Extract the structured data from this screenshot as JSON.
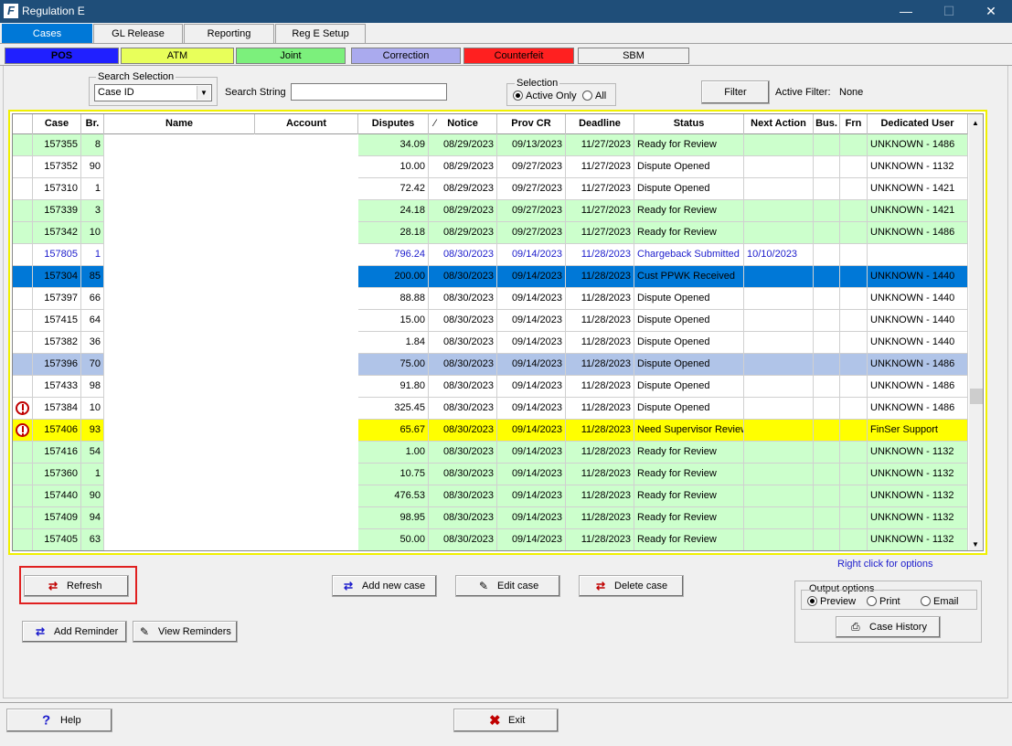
{
  "window": {
    "title": "Regulation E",
    "app_icon": "F",
    "minimize": "—",
    "maximize": "☐",
    "close": "✕"
  },
  "tabs": [
    {
      "label": "Cases",
      "active": true
    },
    {
      "label": "GL Release",
      "active": false
    },
    {
      "label": "Reporting",
      "active": false
    },
    {
      "label": "Reg E Setup",
      "active": false
    }
  ],
  "subtabs": [
    {
      "label": "POS",
      "bg": "#2020ff",
      "fg": "#000000",
      "active": true
    },
    {
      "label": "ATM",
      "bg": "#e8ff5a",
      "fg": "#000000"
    },
    {
      "label": "Joint",
      "bg": "#7cf07c",
      "fg": "#000000"
    },
    {
      "label": "Correction",
      "bg": "#aaaaee",
      "fg": "#000000"
    },
    {
      "label": "Counterfeit",
      "bg": "#ff2020",
      "fg": "#000000"
    },
    {
      "label": "SBM",
      "bg": "#f0f0f0",
      "fg": "#000000"
    }
  ],
  "search": {
    "group_label": "Search Selection",
    "field_value": "Case ID",
    "string_label": "Search String",
    "string_value": ""
  },
  "selection": {
    "group_label": "Selection",
    "active_only": "Active Only",
    "all": "All",
    "selected": "active_only"
  },
  "filter": {
    "button_label": "Filter",
    "active_filter_label": "Active Filter:",
    "active_filter_value": "None"
  },
  "grid": {
    "columns": [
      "",
      "Case",
      "Br.",
      "Name",
      "Account",
      "Disputes",
      "Notice",
      "Prov CR",
      "Deadline",
      "Status",
      "Next Action",
      "Bus.",
      "Frn",
      "Dedicated User"
    ],
    "sort_indicator": "⁄",
    "rows": [
      {
        "alert": false,
        "case": "157355",
        "br": "8",
        "disputes": "34.09",
        "notice": "08/29/2023",
        "prov_cr": "09/13/2023",
        "deadline": "11/27/2023",
        "status": "Ready for Review",
        "next_action": "",
        "bus": "",
        "frn": "",
        "user": "UNKNOWN - 1486",
        "style": "green"
      },
      {
        "alert": false,
        "case": "157352",
        "br": "90",
        "disputes": "10.00",
        "notice": "08/29/2023",
        "prov_cr": "09/27/2023",
        "deadline": "11/27/2023",
        "status": "Dispute Opened",
        "next_action": "",
        "bus": "",
        "frn": "",
        "user": "UNKNOWN - 1132",
        "style": "white"
      },
      {
        "alert": false,
        "case": "157310",
        "br": "1",
        "disputes": "72.42",
        "notice": "08/29/2023",
        "prov_cr": "09/27/2023",
        "deadline": "11/27/2023",
        "status": "Dispute Opened",
        "next_action": "",
        "bus": "",
        "frn": "",
        "user": "UNKNOWN - 1421",
        "style": "white"
      },
      {
        "alert": false,
        "case": "157339",
        "br": "3",
        "disputes": "24.18",
        "notice": "08/29/2023",
        "prov_cr": "09/27/2023",
        "deadline": "11/27/2023",
        "status": "Ready for Review",
        "next_action": "",
        "bus": "",
        "frn": "",
        "user": "UNKNOWN - 1421",
        "style": "green"
      },
      {
        "alert": false,
        "case": "157342",
        "br": "10",
        "disputes": "28.18",
        "notice": "08/29/2023",
        "prov_cr": "09/27/2023",
        "deadline": "11/27/2023",
        "status": "Ready for Review",
        "next_action": "",
        "bus": "",
        "frn": "",
        "user": "UNKNOWN - 1486",
        "style": "green"
      },
      {
        "alert": false,
        "case": "157805",
        "br": "1",
        "disputes": "796.24",
        "notice": "08/30/2023",
        "prov_cr": "09/14/2023",
        "deadline": "11/28/2023",
        "status": "Chargeback Submitted",
        "next_action": "10/10/2023",
        "bus": "",
        "frn": "",
        "user": "",
        "style": "blue-text"
      },
      {
        "alert": false,
        "case": "157304",
        "br": "85",
        "disputes": "200.00",
        "notice": "08/30/2023",
        "prov_cr": "09/14/2023",
        "deadline": "11/28/2023",
        "status": "Cust PPWK Received",
        "next_action": "",
        "bus": "",
        "frn": "",
        "user": "UNKNOWN - 1440",
        "style": "selected"
      },
      {
        "alert": false,
        "case": "157397",
        "br": "66",
        "disputes": "88.88",
        "notice": "08/30/2023",
        "prov_cr": "09/14/2023",
        "deadline": "11/28/2023",
        "status": "Dispute Opened",
        "next_action": "",
        "bus": "",
        "frn": "",
        "user": "UNKNOWN - 1440",
        "style": "white"
      },
      {
        "alert": false,
        "case": "157415",
        "br": "64",
        "disputes": "15.00",
        "notice": "08/30/2023",
        "prov_cr": "09/14/2023",
        "deadline": "11/28/2023",
        "status": "Dispute Opened",
        "next_action": "",
        "bus": "",
        "frn": "",
        "user": "UNKNOWN - 1440",
        "style": "white"
      },
      {
        "alert": false,
        "case": "157382",
        "br": "36",
        "disputes": "1.84",
        "notice": "08/30/2023",
        "prov_cr": "09/14/2023",
        "deadline": "11/28/2023",
        "status": "Dispute Opened",
        "next_action": "",
        "bus": "",
        "frn": "",
        "user": "UNKNOWN - 1440",
        "style": "white"
      },
      {
        "alert": false,
        "case": "157396",
        "br": "70",
        "disputes": "75.00",
        "notice": "08/30/2023",
        "prov_cr": "09/14/2023",
        "deadline": "11/28/2023",
        "status": "Dispute Opened",
        "next_action": "",
        "bus": "",
        "frn": "",
        "user": "UNKNOWN - 1486",
        "style": "lavender"
      },
      {
        "alert": false,
        "case": "157433",
        "br": "98",
        "disputes": "91.80",
        "notice": "08/30/2023",
        "prov_cr": "09/14/2023",
        "deadline": "11/28/2023",
        "status": "Dispute Opened",
        "next_action": "",
        "bus": "",
        "frn": "",
        "user": "UNKNOWN - 1486",
        "style": "white"
      },
      {
        "alert": true,
        "case": "157384",
        "br": "10",
        "disputes": "325.45",
        "notice": "08/30/2023",
        "prov_cr": "09/14/2023",
        "deadline": "11/28/2023",
        "status": "Dispute Opened",
        "next_action": "",
        "bus": "",
        "frn": "",
        "user": "UNKNOWN - 1486",
        "style": "white"
      },
      {
        "alert": true,
        "case": "157406",
        "br": "93",
        "disputes": "65.67",
        "notice": "08/30/2023",
        "prov_cr": "09/14/2023",
        "deadline": "11/28/2023",
        "status": "Need Supervisor Review",
        "next_action": "",
        "bus": "",
        "frn": "",
        "user": "FinSer Support",
        "style": "yellow"
      },
      {
        "alert": false,
        "case": "157416",
        "br": "54",
        "disputes": "1.00",
        "notice": "08/30/2023",
        "prov_cr": "09/14/2023",
        "deadline": "11/28/2023",
        "status": "Ready for Review",
        "next_action": "",
        "bus": "",
        "frn": "",
        "user": "UNKNOWN - 1132",
        "style": "green"
      },
      {
        "alert": false,
        "case": "157360",
        "br": "1",
        "disputes": "10.75",
        "notice": "08/30/2023",
        "prov_cr": "09/14/2023",
        "deadline": "11/28/2023",
        "status": "Ready for Review",
        "next_action": "",
        "bus": "",
        "frn": "",
        "user": "UNKNOWN - 1132",
        "style": "green"
      },
      {
        "alert": false,
        "case": "157440",
        "br": "90",
        "disputes": "476.53",
        "notice": "08/30/2023",
        "prov_cr": "09/14/2023",
        "deadline": "11/28/2023",
        "status": "Ready for Review",
        "next_action": "",
        "bus": "",
        "frn": "",
        "user": "UNKNOWN - 1132",
        "style": "green"
      },
      {
        "alert": false,
        "case": "157409",
        "br": "94",
        "disputes": "98.95",
        "notice": "08/30/2023",
        "prov_cr": "09/14/2023",
        "deadline": "11/28/2023",
        "status": "Ready for Review",
        "next_action": "",
        "bus": "",
        "frn": "",
        "user": "UNKNOWN - 1132",
        "style": "green"
      },
      {
        "alert": false,
        "case": "157405",
        "br": "63",
        "disputes": "50.00",
        "notice": "08/30/2023",
        "prov_cr": "09/14/2023",
        "deadline": "11/28/2023",
        "status": "Ready for Review",
        "next_action": "",
        "bus": "",
        "frn": "",
        "user": "UNKNOWN - 1132",
        "style": "green"
      }
    ]
  },
  "hint": "Right click for options",
  "buttons": {
    "refresh": "Refresh",
    "add_case": "Add new case",
    "edit_case": "Edit case",
    "delete_case": "Delete case",
    "add_reminder": "Add Reminder",
    "view_reminders": "View Reminders",
    "case_history": "Case History",
    "help": "Help",
    "exit": "Exit"
  },
  "output": {
    "group_label": "Output options",
    "preview": "Preview",
    "print": "Print",
    "email": "Email",
    "selected": "preview"
  },
  "colors": {
    "green": "#ccffcc",
    "white": "#ffffff",
    "yellow": "#ffff00",
    "lavender": "#b0c4e8",
    "selected": "#0078d7",
    "blue_text": "#1c1ccc",
    "title_bar": "#1f4e79"
  }
}
